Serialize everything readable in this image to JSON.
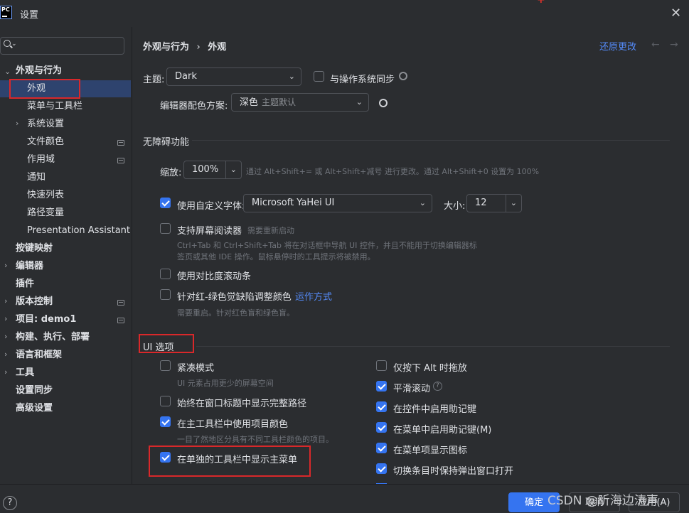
{
  "window": {
    "title": "设置",
    "app_icon_text": "PC"
  },
  "search": {
    "placeholder": ""
  },
  "sidebar": {
    "items": [
      {
        "label": "外观与行为",
        "bold": true,
        "arrow": "expanded"
      },
      {
        "label": "外观",
        "selected": true
      },
      {
        "label": "菜单与工具栏"
      },
      {
        "label": "系统设置",
        "arrow": "collapsed"
      },
      {
        "label": "文件颜色",
        "badge": true
      },
      {
        "label": "作用域",
        "badge": true
      },
      {
        "label": "通知"
      },
      {
        "label": "快速列表"
      },
      {
        "label": "路径变量"
      },
      {
        "label": "Presentation Assistant"
      },
      {
        "label": "按键映射",
        "bold": true
      },
      {
        "label": "编辑器",
        "bold": true,
        "arrow": "collapsed"
      },
      {
        "label": "插件",
        "bold": true
      },
      {
        "label": "版本控制",
        "bold": true,
        "arrow": "collapsed",
        "badge": true
      },
      {
        "label": "项目: demo1",
        "bold": true,
        "arrow": "collapsed",
        "badge": true
      },
      {
        "label": "构建、执行、部署",
        "bold": true,
        "arrow": "collapsed"
      },
      {
        "label": "语言和框架",
        "bold": true,
        "arrow": "collapsed"
      },
      {
        "label": "工具",
        "bold": true,
        "arrow": "collapsed"
      },
      {
        "label": "设置同步",
        "bold": true
      },
      {
        "label": "高级设置",
        "bold": true
      }
    ]
  },
  "header": {
    "breadcrumb_parent": "外观与行为",
    "breadcrumb_sep": "›",
    "breadcrumb_current": "外观",
    "restore_label": "还原更改",
    "back_arrow": "←",
    "forward_arrow": "→"
  },
  "theme": {
    "label": "主题:",
    "value": "Dark",
    "sync_label": "与操作系统同步",
    "sync_checked": false
  },
  "scheme": {
    "label": "编辑器配色方案:",
    "value": "深色",
    "sub": "主题默认"
  },
  "accessibility": {
    "title": "无障碍功能",
    "zoom_label": "缩放:",
    "zoom_value": "100%",
    "zoom_hint": "通过 Alt+Shift+= 或 Alt+Shift+减号 进行更改。通过 Alt+Shift+0 设置为 100%",
    "custom_font_label": "使用自定义字体:",
    "custom_font_checked": true,
    "font_value": "Microsoft YaHei UI",
    "size_label": "大小:",
    "size_value": "12",
    "screen_reader_label": "支持屏幕阅读器",
    "screen_reader_hint": "需要重新启动",
    "screen_reader_desc1": "Ctrl+Tab 和 Ctrl+Shift+Tab 将在对话框中导航 UI 控件，并且不能用于切换编辑器标",
    "screen_reader_desc2": "签页或其他 IDE 操作。鼠标悬停时的工具提示将被禁用。",
    "contrast_scroll_label": "使用对比度滚动条",
    "color_blind_label": "针对红-绿色觉缺陷调整颜色",
    "color_blind_link": "运作方式",
    "color_blind_hint": "需要重启。针对红色盲和绿色盲。"
  },
  "ui_options": {
    "title": "UI 选项",
    "compact_label": "紧凑模式",
    "compact_hint": "UI 元素占用更少的屏幕空间",
    "full_path_label": "始终在窗口标题中显示完整路径",
    "project_colors_label": "在主工具栏中使用项目颜色",
    "project_colors_hint": "一目了然地区分具有不同工具栏颜色的项目。",
    "main_menu_label": "在单独的工具栏中显示主菜单",
    "drag_alt_label": "仅按下 Alt 时拖放",
    "smooth_scroll_label": "平滑滚动",
    "mnemonic_controls_label": "在控件中启用助记键",
    "mnemonic_menu_label": "在菜单中启用助记键(M)",
    "menu_icons_label": "在菜单项显示图标",
    "keep_popup_label": "切换条目时保持弹出窗口打开"
  },
  "footer": {
    "help": "?",
    "ok_label": "确定",
    "cancel_label": "取消",
    "apply_label": "应用(A)"
  },
  "watermark": "CSDN @听海边涛声",
  "colors": {
    "accent": "#3574f0",
    "link": "#548af7",
    "highlight_box": "#d9282a",
    "selection": "#2e436e"
  }
}
